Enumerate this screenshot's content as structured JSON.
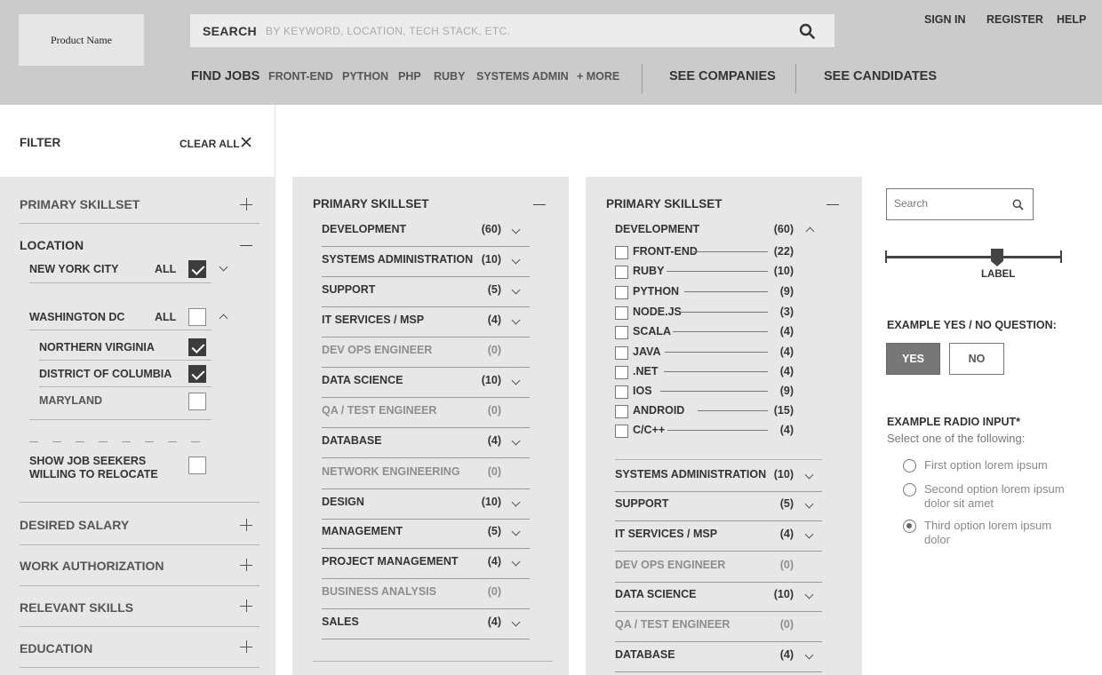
{
  "header": {
    "logo": "Product Name",
    "search_label": "SEARCH",
    "search_placeholder": "BY KEYWORD, LOCATION, TECH STACK, ETC.",
    "top_links": [
      "SIGN IN",
      "REGISTER",
      "HELP"
    ],
    "find_jobs": "FIND JOBS",
    "job_links": [
      "FRONT-END",
      "PYTHON",
      "PHP",
      "RUBY",
      "SYSTEMS ADMIN",
      "+ MORE"
    ],
    "see_companies": "SEE COMPANIES",
    "see_candidates": "SEE CANDIDATES"
  },
  "filter": {
    "title": "FILTER",
    "clear_all": "CLEAR ALL",
    "primary_skillset": "PRIMARY SKILLSET",
    "location": "LOCATION",
    "nyc": "NEW YORK CITY",
    "all": "ALL",
    "washington": "WASHINGTON DC",
    "northern_virginia": "NORTHERN VIRGINIA",
    "district_of_columbia": "DISTRICT OF COLUMBIA",
    "maryland": "MARYLAND",
    "relocate": "SHOW JOB SEEKERS WILLING TO RELOCATE",
    "desired_salary": "DESIRED SALARY",
    "work_authorization": "WORK AUTHORIZATION",
    "relevant_skills": "RELEVANT SKILLS",
    "education": "EDUCATION"
  },
  "panel1": {
    "title": "PRIMARY SKILLSET",
    "items": [
      {
        "label": "DEVELOPMENT",
        "count": "(60)"
      },
      {
        "label": "SYSTEMS ADMINISTRATION",
        "count": "(10)"
      },
      {
        "label": "SUPPORT",
        "count": "(5)"
      },
      {
        "label": "IT SERVICES / MSP",
        "count": "(4)"
      },
      {
        "label": "DEV OPS ENGINEER",
        "count": "(0)"
      },
      {
        "label": "DATA SCIENCE",
        "count": "(10)"
      },
      {
        "label": "QA / TEST ENGINEER",
        "count": "(0)"
      },
      {
        "label": "DATABASE",
        "count": "(4)"
      },
      {
        "label": "NETWORK ENGINEERING",
        "count": "(0)"
      },
      {
        "label": "DESIGN",
        "count": "(10)"
      },
      {
        "label": "MANAGEMENT",
        "count": "(5)"
      },
      {
        "label": "PROJECT MANAGEMENT",
        "count": "(4)"
      },
      {
        "label": "BUSINESS ANALYSIS",
        "count": "(0)"
      },
      {
        "label": "SALES",
        "count": "(4)"
      }
    ]
  },
  "panel2": {
    "title": "PRIMARY SKILLSET",
    "development": {
      "label": "DEVELOPMENT",
      "count": "(60)"
    },
    "subs": [
      {
        "label": "FRONT-END",
        "count": "(22)"
      },
      {
        "label": "RUBY",
        "count": "(10)"
      },
      {
        "label": "PYTHON",
        "count": "(9)"
      },
      {
        "label": "NODE.JS",
        "count": "(3)"
      },
      {
        "label": "SCALA",
        "count": "(4)"
      },
      {
        "label": "JAVA",
        "count": "(4)"
      },
      {
        "label": ".NET",
        "count": "(4)"
      },
      {
        "label": "IOS",
        "count": "(9)"
      },
      {
        "label": "ANDROID",
        "count": "(15)"
      },
      {
        "label": "C/C++",
        "count": "(4)"
      }
    ],
    "items": [
      {
        "label": "SYSTEMS ADMINISTRATION",
        "count": "(10)"
      },
      {
        "label": "SUPPORT",
        "count": "(5)"
      },
      {
        "label": "IT SERVICES / MSP",
        "count": "(4)"
      },
      {
        "label": "DEV OPS ENGINEER",
        "count": "(0)"
      },
      {
        "label": "DATA SCIENCE",
        "count": "(10)"
      },
      {
        "label": "QA / TEST ENGINEER",
        "count": "(0)"
      },
      {
        "label": "DATABASE",
        "count": "(4)"
      }
    ]
  },
  "widgets": {
    "search_placeholder": "Search",
    "slider_label": "LABEL",
    "yes_no_question": "EXAMPLE YES / NO QUESTION:",
    "yes": "YES",
    "no": "NO",
    "radio_title": "EXAMPLE RADIO INPUT*",
    "radio_subtitle": "Select one of the following:",
    "radio_options": [
      "First option lorem ipsum",
      "Second option lorem ipsum dolor sit amet",
      "Third option lorem ipsum dolor"
    ]
  }
}
